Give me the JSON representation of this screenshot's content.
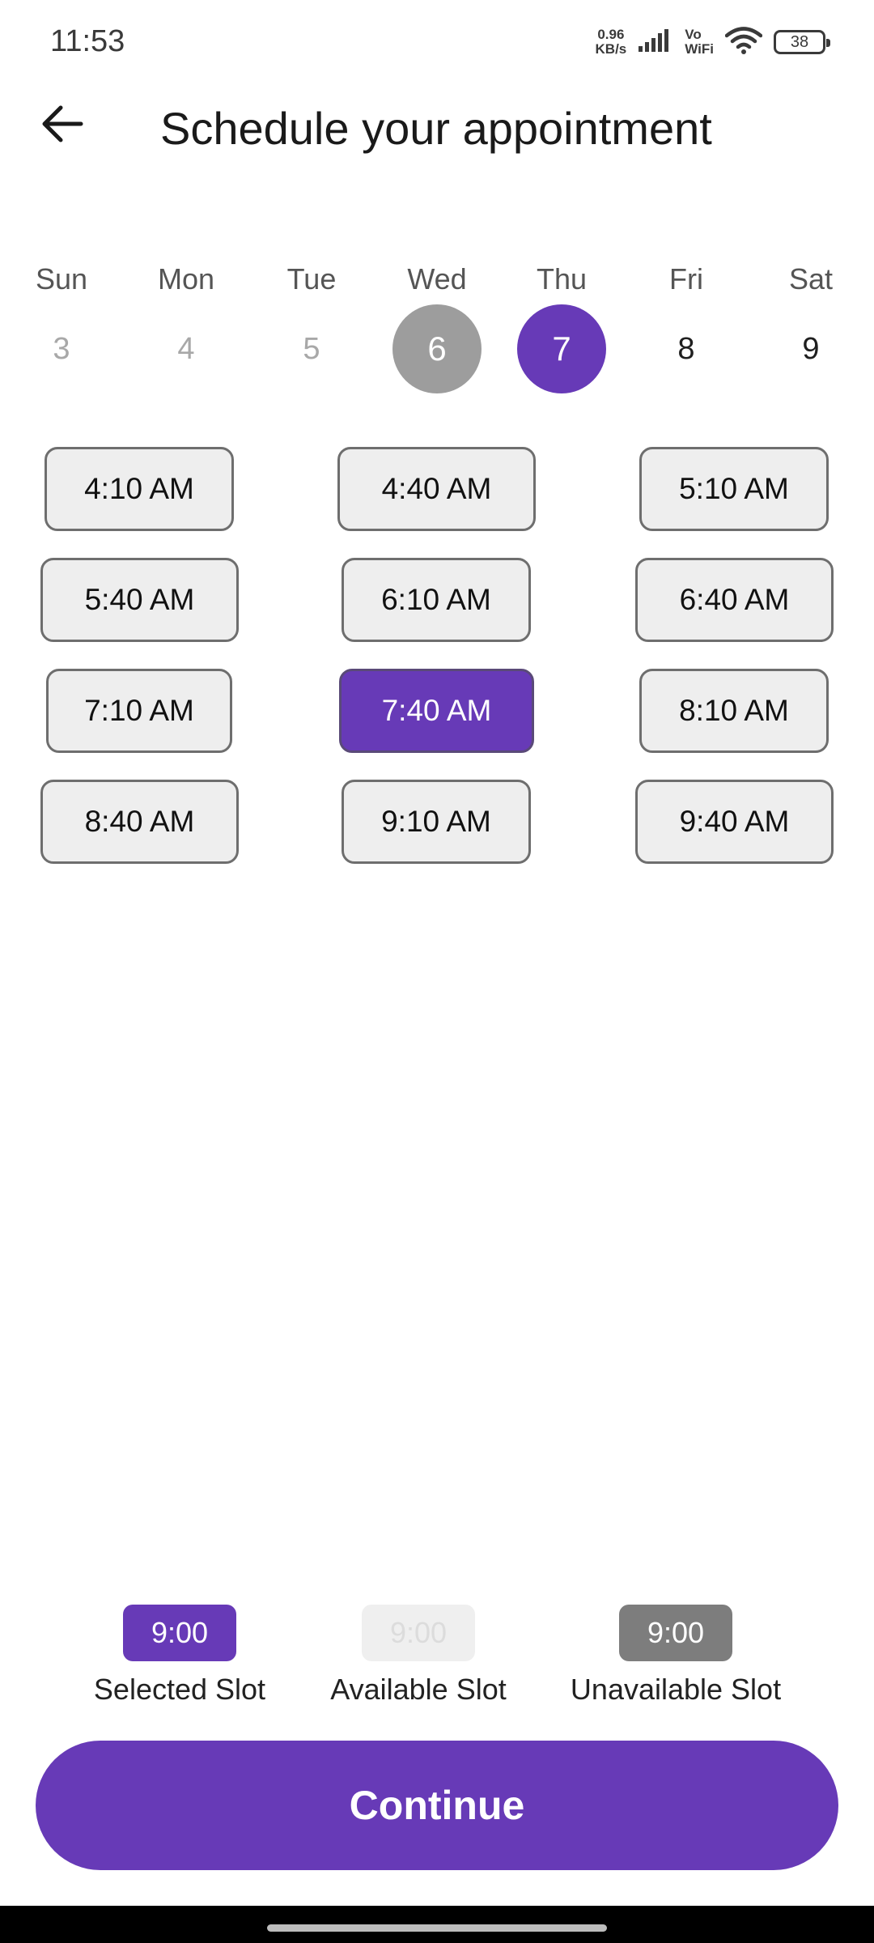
{
  "status_bar": {
    "time": "11:53",
    "net_speed_value": "0.96",
    "net_speed_unit": "KB/s",
    "vowifi_top": "Vo",
    "vowifi_bottom": "WiFi",
    "battery": "38",
    "icons": [
      "signal-icon",
      "wifi-icon",
      "battery-icon"
    ]
  },
  "header": {
    "back_icon": "arrow-left-icon",
    "title": "Schedule your appointment"
  },
  "week": {
    "days": [
      {
        "name": "Sun",
        "number": "3",
        "state": "past"
      },
      {
        "name": "Mon",
        "number": "4",
        "state": "past"
      },
      {
        "name": "Tue",
        "number": "5",
        "state": "past"
      },
      {
        "name": "Wed",
        "number": "6",
        "state": "unavailable"
      },
      {
        "name": "Thu",
        "number": "7",
        "state": "selected"
      },
      {
        "name": "Fri",
        "number": "8",
        "state": "available"
      },
      {
        "name": "Sat",
        "number": "9",
        "state": "available"
      }
    ]
  },
  "slots": [
    {
      "time": "4:10 AM",
      "selected": false
    },
    {
      "time": "4:40 AM",
      "selected": false
    },
    {
      "time": "5:10 AM",
      "selected": false
    },
    {
      "time": "5:40 AM",
      "selected": false
    },
    {
      "time": "6:10 AM",
      "selected": false
    },
    {
      "time": "6:40 AM",
      "selected": false
    },
    {
      "time": "7:10 AM",
      "selected": false
    },
    {
      "time": "7:40 AM",
      "selected": true
    },
    {
      "time": "8:10 AM",
      "selected": false
    },
    {
      "time": "8:40 AM",
      "selected": false
    },
    {
      "time": "9:10 AM",
      "selected": false
    },
    {
      "time": "9:40 AM",
      "selected": false
    }
  ],
  "legend": {
    "selected": {
      "chip": "9:00",
      "label": "Selected Slot"
    },
    "available": {
      "chip": "9:00",
      "label": "Available Slot"
    },
    "unavailable": {
      "chip": "9:00",
      "label": "Unavailable Slot"
    }
  },
  "continue_label": "Continue",
  "colors": {
    "accent": "#673ab7",
    "unavailable": "#9d9d9d",
    "slot_bg": "#eeeeee",
    "legend_unavailable": "#7d7d7d"
  }
}
